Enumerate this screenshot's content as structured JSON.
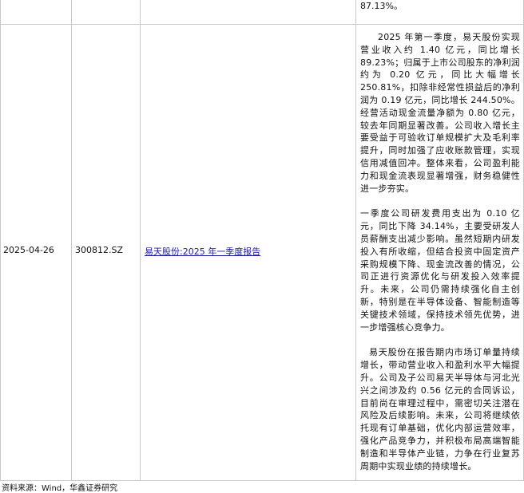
{
  "top_row": {
    "summary_tail": "87.13%。"
  },
  "main_row": {
    "date": "2025-04-26",
    "code": "300812.SZ",
    "report_link": "易天股份:2025 年一季度报告",
    "summary": {
      "p1": "2025 年第一季度，易天股份实现营业收入约 1.40 亿元，同比增长 89.23%；归属于上市公司股东的净利润约为 0.20 亿元，同比大幅增长 250.81%，扣除非经常性损益后的净利润为 0.19 亿元，同比增长 244.50%。经营活动现金流量净额为 0.80 亿元，较去年同期显著改善。公司收入增长主要受益于可验收订单规模扩大及毛利率提升，同时加强了应收账款管理，实现信用减值回冲。整体来看，公司盈利能力和现金流表现显著增强，财务稳健性进一步夯实。",
      "p2": "一季度公司研发费用支出为 0.10 亿元，同比下降 34.14%，主要受研发人员薪酬支出减少影响。虽然短期内研发投入有所收缩，但结合投资中固定资产采购规模下降、现金流改善的情况，公司正进行资源优化与研发投入效率提升。未来，公司仍需持续强化自主创新，特别是在半导体设备、智能制造等关键技术领域，保持技术领先优势，进一步增强核心竞争力。",
      "p3": "易天股份在报告期内市场订单量持续增长，带动营业收入和盈利水平大幅提升。公司及子公司易天半导体与河北光兴之间涉及约 0.56 亿元的合同诉讼，目前尚在审理过程中，需密切关注潜在风险及后续影响。未来，公司将继续依托现有订单基础，优化内部运营效率，强化产品竞争力，并积极布局高端智能制造和半导体产业链，力争在行业复苏周期中实现业绩的持续增长。"
    }
  },
  "footer": {
    "source": "资料来源：Wind，华鑫证券研究"
  }
}
